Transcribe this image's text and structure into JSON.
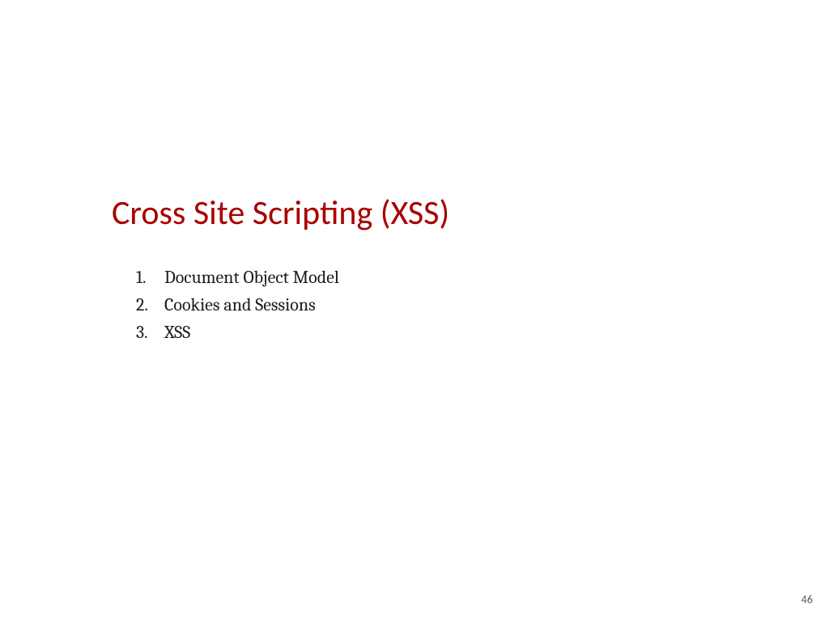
{
  "slide": {
    "title": "Cross Site Scripting (XSS)",
    "items": [
      {
        "number": "1.",
        "text": "Document Object Model"
      },
      {
        "number": "2.",
        "text": "Cookies and Sessions"
      },
      {
        "number": "3.",
        "text": "XSS"
      }
    ],
    "pageNumber": "46"
  }
}
